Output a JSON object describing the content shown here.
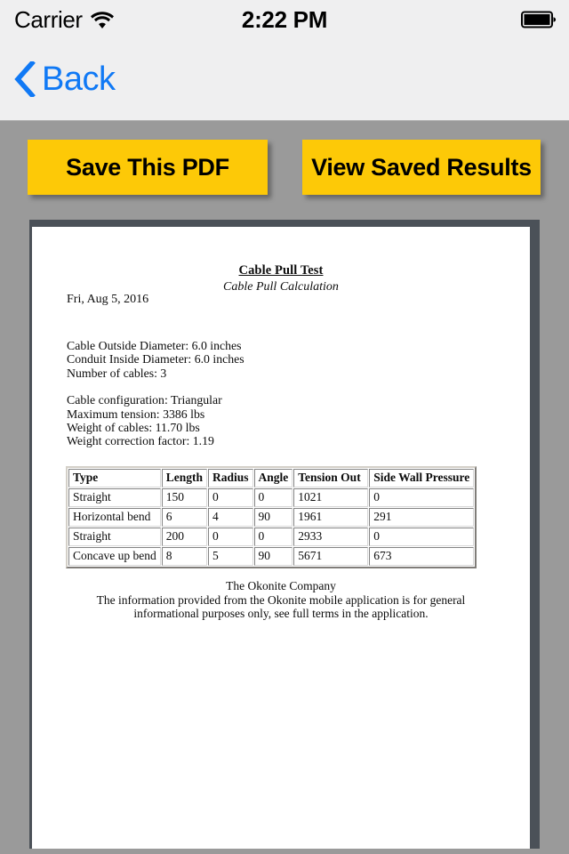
{
  "status_bar": {
    "carrier": "Carrier",
    "wifi_icon": "wifi-icon",
    "time": "2:22 PM",
    "battery_icon": "battery-full-icon"
  },
  "nav_bar": {
    "back_label": "Back",
    "back_icon": "chevron-left-icon",
    "accent_color": "#1079f5"
  },
  "actions": {
    "save_label": "Save This PDF",
    "view_label": "View Saved Results",
    "button_color": "#fdc907",
    "button_text_color": "#000000"
  },
  "document": {
    "title": "Cable Pull Test",
    "subtitle": "Cable Pull Calculation",
    "date": "Fri, Aug 5, 2016",
    "params_group_1": [
      "Cable Outside Diameter: 6.0 inches",
      "Conduit Inside Diameter: 6.0 inches",
      "Number of cables: 3"
    ],
    "params_group_2": [
      "Cable configuration: Triangular",
      "Maximum tension: 3386 lbs",
      "Weight of cables: 11.70 lbs",
      "Weight correction factor: 1.19"
    ],
    "table": {
      "headers": [
        "Type",
        "Length",
        "Radius",
        "Angle",
        "Tension Out",
        "Side Wall Pressure"
      ],
      "rows": [
        [
          "Straight",
          "150",
          "0",
          "0",
          "1021",
          "0"
        ],
        [
          "Horizontal bend",
          "6",
          "4",
          "90",
          "1961",
          "291"
        ],
        [
          "Straight",
          "200",
          "0",
          "0",
          "2933",
          "0"
        ],
        [
          "Concave up bend",
          "8",
          "5",
          "90",
          "5671",
          "673"
        ]
      ]
    },
    "footer": {
      "company": "The Okonite Company",
      "disclaimer": "The information provided from the Okonite mobile application is for general informational purposes only, see full terms in the application."
    }
  }
}
